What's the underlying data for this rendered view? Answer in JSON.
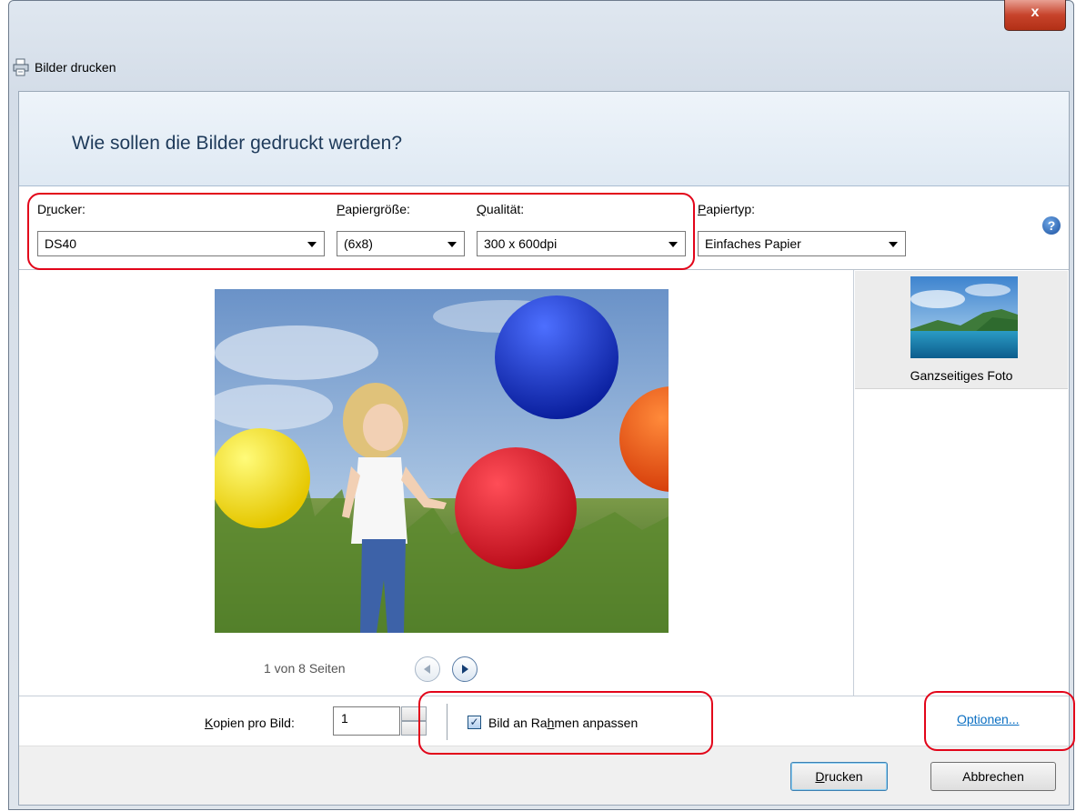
{
  "window": {
    "title": "Bilder drucken",
    "close_glyph": "x"
  },
  "header": {
    "heading": "Wie sollen die Bilder gedruckt werden?"
  },
  "settings": {
    "printer": {
      "label_ul": "r",
      "label_pre": "D",
      "label_post": "ucker:",
      "value": "DS40"
    },
    "paper_size": {
      "label_ul": "P",
      "label_post": "apiergröße:",
      "value": "(6x8)"
    },
    "quality": {
      "label_ul": "Q",
      "label_post": "ualität:",
      "value": "300 x 600dpi"
    },
    "paper_type": {
      "label_ul": "P",
      "label_post": "apiertyp:",
      "value": "Einfaches Papier"
    },
    "help_glyph": "?"
  },
  "preview": {
    "page_info": "1 von 8 Seiten"
  },
  "layouts": {
    "items": [
      {
        "label": "Ganzseitiges Foto"
      }
    ]
  },
  "bottom": {
    "copies_label_ul": "K",
    "copies_label_post": "opien pro Bild:",
    "copies_value": "1",
    "fit_checked": true,
    "fit_label_pre": "Bild an Ra",
    "fit_label_ul": "h",
    "fit_label_post": "men anpassen",
    "options_link": "Optionen..."
  },
  "footer": {
    "print_ul": "D",
    "print_post": "rucken",
    "cancel": "Abbrechen"
  },
  "colors": {
    "highlight_red": "#e2051a",
    "heading_blue": "#1e3a5a",
    "link_blue": "#0b6fc2"
  }
}
